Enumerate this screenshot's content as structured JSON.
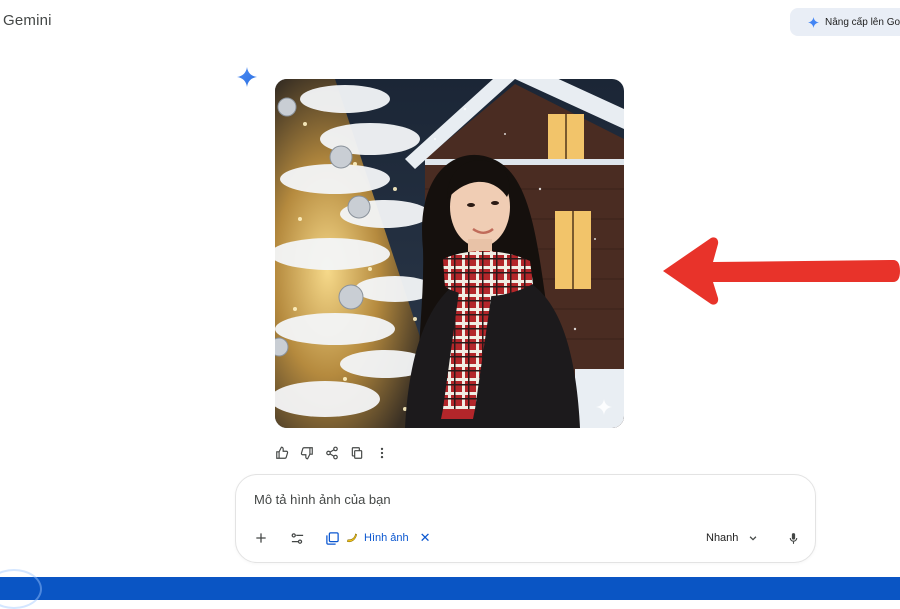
{
  "app": {
    "title": "Gemini"
  },
  "header": {
    "upgrade_label": "Nâng cấp lên Google AI Pro"
  },
  "response": {
    "image_alt": "Generated image: woman in red plaid scarf beside snowy Christmas tree",
    "actions": [
      "thumb-up-icon",
      "thumb-down-icon",
      "share-icon",
      "copy-icon",
      "more-vert-icon"
    ]
  },
  "prompt": {
    "placeholder": "Mô tả hình ảnh của bạn",
    "value": "",
    "chip_label": "Hình ảnh",
    "chip_close": "✕",
    "mode_label": "Nhanh"
  },
  "colors": {
    "accent_blue": "#0b57d0",
    "arrow_red": "#e8332a",
    "taskbar": "#0a55c4",
    "upgrade_bg": "#e9eef6"
  }
}
